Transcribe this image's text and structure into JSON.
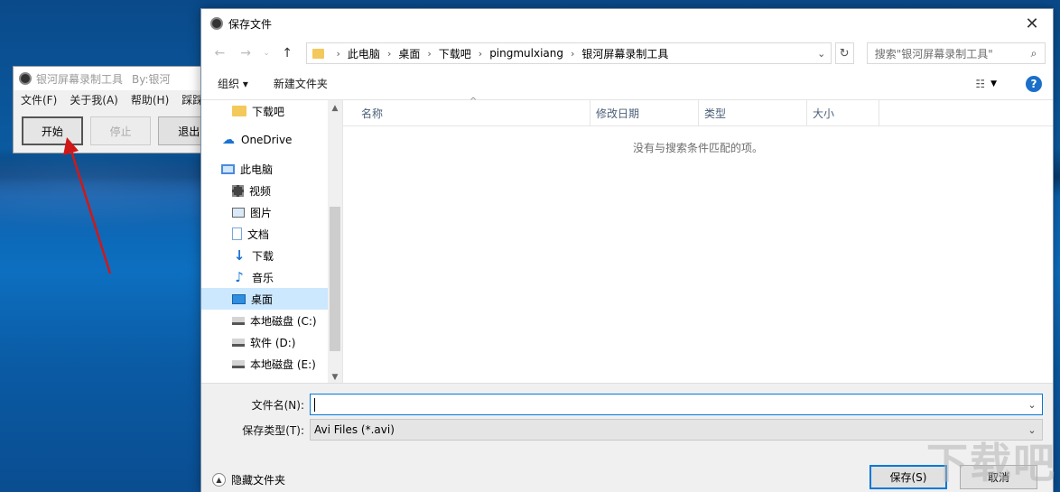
{
  "app_window": {
    "title": "银河屏幕录制工具",
    "author": "By:银河",
    "menu": [
      "文件(F)",
      "关于我(A)",
      "帮助(H)",
      "踩踩"
    ],
    "buttons": {
      "start": "开始",
      "stop": "停止",
      "exit": "退出"
    }
  },
  "dialog": {
    "title": "保存文件",
    "breadcrumb": [
      "此电脑",
      "桌面",
      "下载吧",
      "pingmulxiang",
      "银河屏幕录制工具"
    ],
    "search_placeholder": "搜索\"银河屏幕录制工具\"",
    "toolbar": {
      "organize": "组织",
      "new_folder": "新建文件夹"
    },
    "nav_items": [
      {
        "label": "下载吧",
        "icon": "folder-icon"
      },
      {
        "label": "OneDrive",
        "icon": "cloud-icon"
      },
      {
        "label": "此电脑",
        "icon": "computer-icon"
      },
      {
        "label": "视频",
        "icon": "video-icon"
      },
      {
        "label": "图片",
        "icon": "picture-icon"
      },
      {
        "label": "文档",
        "icon": "document-icon"
      },
      {
        "label": "下载",
        "icon": "download-icon"
      },
      {
        "label": "音乐",
        "icon": "music-icon"
      },
      {
        "label": "桌面",
        "icon": "desktop-icon",
        "selected": true
      },
      {
        "label": "本地磁盘 (C:)",
        "icon": "drive-icon"
      },
      {
        "label": "软件 (D:)",
        "icon": "drive-icon"
      },
      {
        "label": "本地磁盘 (E:)",
        "icon": "drive-icon"
      }
    ],
    "columns": [
      "名称",
      "修改日期",
      "类型",
      "大小"
    ],
    "empty_message": "没有与搜索条件匹配的项。",
    "filename_label": "文件名(N):",
    "filename_value": "",
    "filetype_label": "保存类型(T):",
    "filetype_value": "Avi Files (*.avi)",
    "hide_folders": "隐藏文件夹",
    "save_button": "保存(S)",
    "cancel_button": "取消"
  },
  "watermark": "下载吧"
}
